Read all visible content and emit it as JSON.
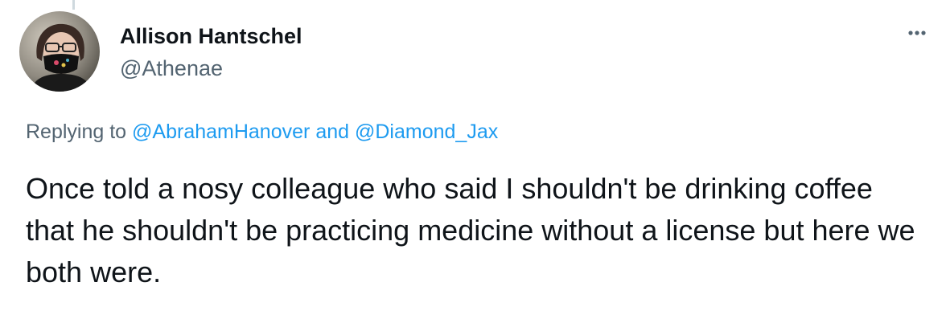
{
  "tweet": {
    "display_name": "Allison Hantschel",
    "handle": "@Athenae",
    "more_icon": "more-dots-icon",
    "replying": {
      "prefix": "Replying to",
      "mention_1": "@AbrahamHanover",
      "conjunction": "and",
      "mention_2": "@Diamond_Jax"
    },
    "text": "Once told a nosy colleague who said I shouldn't be drinking coffee that he shouldn't be practicing medicine without a license but here we both were."
  },
  "colors": {
    "text_primary": "#0f1419",
    "text_secondary": "#536471",
    "link": "#1d9bf0"
  }
}
